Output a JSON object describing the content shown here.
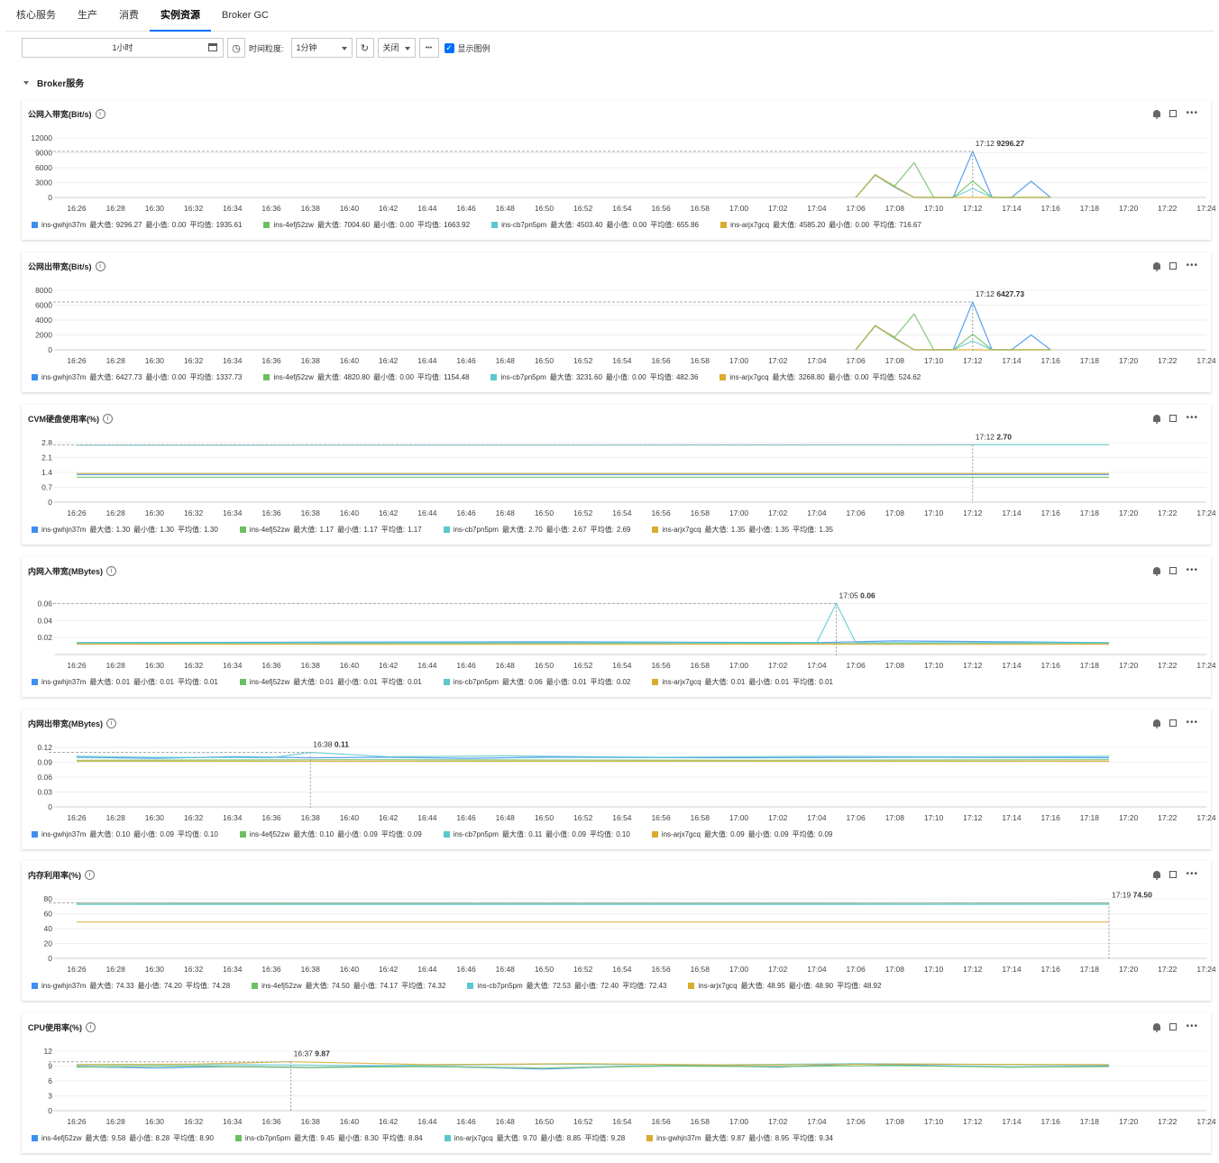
{
  "tabs": [
    {
      "label": "核心服务",
      "active": false
    },
    {
      "label": "生产",
      "active": false
    },
    {
      "label": "消费",
      "active": false
    },
    {
      "label": "实例资源",
      "active": true
    },
    {
      "label": "Broker GC",
      "active": false
    }
  ],
  "toolbar": {
    "range_value": "1小时",
    "granularity_label": "时间粒度:",
    "granularity_value": "1分钟",
    "refresh_value": "关闭",
    "more_label": "•••",
    "show_legend_label": "显示图例"
  },
  "section_title": "Broker服务",
  "legend_labels": {
    "max": "最大值:",
    "min": "最小值:",
    "avg": "平均值:"
  },
  "colors": {
    "blue": "#3d8ff0",
    "green": "#6cbf62",
    "teal": "#5bc8cf",
    "gold": "#d8ac2c",
    "accent": "#006eff"
  },
  "x_ticks": [
    "16:26",
    "16:28",
    "16:30",
    "16:32",
    "16:34",
    "16:36",
    "16:38",
    "16:40",
    "16:42",
    "16:44",
    "16:46",
    "16:48",
    "16:50",
    "16:52",
    "16:54",
    "16:56",
    "16:58",
    "17:00",
    "17:02",
    "17:04",
    "17:06",
    "17:08",
    "17:10",
    "17:12",
    "17:14",
    "17:16",
    "17:18",
    "17:20",
    "17:22",
    "17:24"
  ],
  "chart_data": [
    {
      "type": "line",
      "title": "公网入带宽(Bit/s)",
      "ylim": [
        0,
        12000
      ],
      "yticks": [
        "12000",
        "9000",
        "6000",
        "3000",
        "0"
      ],
      "x_range": [
        "16:26",
        "17:24"
      ],
      "tooltip": {
        "time": "17:12",
        "value": "9296.27"
      },
      "series": [
        {
          "name": "ins-gwhjn37m",
          "color": "blue",
          "max": "9296.27",
          "min": "0.00",
          "avg": "1935.61",
          "x": [
            "17:06",
            "17:07",
            "17:08",
            "17:09",
            "17:10",
            "17:11",
            "17:12",
            "17:13",
            "17:14",
            "17:15",
            "17:16"
          ],
          "values": [
            0,
            4585,
            2200,
            0,
            0,
            0,
            9296,
            0,
            0,
            3268,
            0
          ]
        },
        {
          "name": "ins-4efj52zw",
          "color": "green",
          "max": "7004.60",
          "min": "0.00",
          "avg": "1663.92",
          "x": [
            "17:06",
            "17:07",
            "17:08",
            "17:09",
            "17:10",
            "17:11",
            "17:12",
            "17:13",
            "17:14",
            "17:15",
            "17:16"
          ],
          "values": [
            0,
            4500,
            2300,
            7004,
            0,
            0,
            3300,
            0,
            0,
            0,
            0
          ]
        },
        {
          "name": "ins-cb7pn5pm",
          "color": "teal",
          "max": "4503.40",
          "min": "0.00",
          "avg": "655.86",
          "x": [
            "17:06",
            "17:07",
            "17:08",
            "17:09",
            "17:10",
            "17:11",
            "17:12",
            "17:13",
            "17:14",
            "17:15",
            "17:16"
          ],
          "values": [
            0,
            4503,
            2000,
            0,
            0,
            0,
            1800,
            0,
            0,
            0,
            0
          ]
        },
        {
          "name": "ins-arjx7gcq",
          "color": "gold",
          "max": "4585.20",
          "min": "0.00",
          "avg": "716.67",
          "x": [
            "17:06",
            "17:07",
            "17:08",
            "17:09",
            "17:10",
            "17:11",
            "17:12",
            "17:13",
            "17:14",
            "17:15",
            "17:16"
          ],
          "values": [
            0,
            4585,
            2200,
            0,
            0,
            0,
            0,
            0,
            0,
            0,
            0
          ]
        }
      ]
    },
    {
      "type": "line",
      "title": "公网出带宽(Bit/s)",
      "ylim": [
        0,
        8000
      ],
      "yticks": [
        "8000",
        "6000",
        "4000",
        "2000",
        "0"
      ],
      "x_range": [
        "16:26",
        "17:24"
      ],
      "tooltip": {
        "time": "17:12",
        "value": "6427.73"
      },
      "series": [
        {
          "name": "ins-gwhjn37m",
          "color": "blue",
          "max": "6427.73",
          "min": "0.00",
          "avg": "1337.73",
          "x": [
            "17:06",
            "17:07",
            "17:08",
            "17:09",
            "17:10",
            "17:11",
            "17:12",
            "17:13",
            "17:14",
            "17:15",
            "17:16"
          ],
          "values": [
            0,
            3268,
            1600,
            0,
            0,
            0,
            6427,
            0,
            0,
            2000,
            0
          ]
        },
        {
          "name": "ins-4efj52zw",
          "color": "green",
          "max": "4820.80",
          "min": "0.00",
          "avg": "1154.48",
          "x": [
            "17:06",
            "17:07",
            "17:08",
            "17:09",
            "17:10",
            "17:11",
            "17:12",
            "17:13",
            "17:14",
            "17:15",
            "17:16"
          ],
          "values": [
            0,
            3200,
            1700,
            4820,
            0,
            0,
            2100,
            0,
            0,
            0,
            0
          ]
        },
        {
          "name": "ins-cb7pn5pm",
          "color": "teal",
          "max": "3231.60",
          "min": "0.00",
          "avg": "482.36",
          "x": [
            "17:06",
            "17:07",
            "17:08",
            "17:09",
            "17:10",
            "17:11",
            "17:12",
            "17:13",
            "17:14",
            "17:15",
            "17:16"
          ],
          "values": [
            0,
            3231,
            1500,
            0,
            0,
            0,
            1200,
            0,
            0,
            0,
            0
          ]
        },
        {
          "name": "ins-arjx7gcq",
          "color": "gold",
          "max": "3268.80",
          "min": "0.00",
          "avg": "524.62",
          "x": [
            "17:06",
            "17:07",
            "17:08",
            "17:09",
            "17:10",
            "17:11",
            "17:12",
            "17:13",
            "17:14",
            "17:15",
            "17:16"
          ],
          "values": [
            0,
            3268,
            1600,
            0,
            0,
            0,
            0,
            0,
            0,
            0,
            0
          ]
        }
      ]
    },
    {
      "type": "line",
      "title": "CVM硬盘使用率(%)",
      "ylim": [
        0,
        2.8
      ],
      "yticks": [
        "2.8",
        "2.1",
        "1.4",
        "0.7",
        "0"
      ],
      "x_range": [
        "16:26",
        "17:24"
      ],
      "tooltip": {
        "time": "17:12",
        "value": "2.70"
      },
      "series": [
        {
          "name": "ins-gwhjn37m",
          "color": "blue",
          "max": "1.30",
          "min": "1.30",
          "avg": "1.30",
          "x": [
            "16:26",
            "17:19"
          ],
          "values": [
            1.3,
            1.3
          ]
        },
        {
          "name": "ins-4efj52zw",
          "color": "green",
          "max": "1.17",
          "min": "1.17",
          "avg": "1.17",
          "x": [
            "16:26",
            "17:19"
          ],
          "values": [
            1.17,
            1.17
          ]
        },
        {
          "name": "ins-cb7pn5pm",
          "color": "teal",
          "max": "2.70",
          "min": "2.67",
          "avg": "2.69",
          "x": [
            "16:26",
            "16:50",
            "17:12",
            "17:19"
          ],
          "values": [
            2.68,
            2.69,
            2.7,
            2.7
          ]
        },
        {
          "name": "ins-arjx7gcq",
          "color": "gold",
          "max": "1.35",
          "min": "1.35",
          "avg": "1.35",
          "x": [
            "16:26",
            "17:19"
          ],
          "values": [
            1.35,
            1.35
          ]
        }
      ]
    },
    {
      "type": "line",
      "title": "内网入带宽(MBytes)",
      "ylim": [
        0,
        0.07
      ],
      "yticks": [
        "0.06",
        "0.04",
        "0.02"
      ],
      "ytick_values": [
        0.06,
        0.04,
        0.02
      ],
      "x_range": [
        "16:26",
        "17:24"
      ],
      "tooltip": {
        "time": "17:05",
        "value": "0.06"
      },
      "series": [
        {
          "name": "ins-gwhjn37m",
          "color": "blue",
          "max": "0.01",
          "min": "0.01",
          "avg": "0.01",
          "x": [
            "16:26",
            "16:50",
            "17:04",
            "17:08",
            "17:19"
          ],
          "values": [
            0.014,
            0.015,
            0.014,
            0.016,
            0.014
          ]
        },
        {
          "name": "ins-4efj52zw",
          "color": "green",
          "max": "0.01",
          "min": "0.01",
          "avg": "0.01",
          "x": [
            "16:26",
            "17:19"
          ],
          "values": [
            0.013,
            0.013
          ]
        },
        {
          "name": "ins-cb7pn5pm",
          "color": "teal",
          "max": "0.06",
          "min": "0.01",
          "avg": "0.02",
          "x": [
            "16:26",
            "17:04",
            "17:05",
            "17:06",
            "17:19"
          ],
          "values": [
            0.014,
            0.014,
            0.06,
            0.014,
            0.014
          ]
        },
        {
          "name": "ins-arjx7gcq",
          "color": "gold",
          "max": "0.01",
          "min": "0.01",
          "avg": "0.01",
          "x": [
            "16:26",
            "17:19"
          ],
          "values": [
            0.012,
            0.012
          ]
        }
      ]
    },
    {
      "type": "line",
      "title": "内网出带宽(MBytes)",
      "ylim": [
        0,
        0.12
      ],
      "yticks": [
        "0.12",
        "0.09",
        "0.06",
        "0.03",
        "0"
      ],
      "x_range": [
        "16:26",
        "17:24"
      ],
      "tooltip": {
        "time": "16:38",
        "value": "0.11"
      },
      "series": [
        {
          "name": "ins-gwhjn37m",
          "color": "blue",
          "max": "0.10",
          "min": "0.09",
          "avg": "0.10",
          "x": [
            "16:26",
            "16:30",
            "16:34",
            "16:38",
            "16:42",
            "16:46",
            "16:50",
            "17:00",
            "17:10",
            "17:19"
          ],
          "values": [
            0.1,
            0.098,
            0.101,
            0.099,
            0.1,
            0.098,
            0.1,
            0.099,
            0.1,
            0.099
          ]
        },
        {
          "name": "ins-4efj52zw",
          "color": "green",
          "max": "0.10",
          "min": "0.09",
          "avg": "0.09",
          "x": [
            "16:26",
            "16:40",
            "17:00",
            "17:19"
          ],
          "values": [
            0.094,
            0.095,
            0.094,
            0.095
          ]
        },
        {
          "name": "ins-cb7pn5pm",
          "color": "teal",
          "max": "0.11",
          "min": "0.09",
          "avg": "0.10",
          "x": [
            "16:26",
            "16:30",
            "16:36",
            "16:38",
            "16:42",
            "16:48",
            "16:56",
            "17:04",
            "17:12",
            "17:19"
          ],
          "values": [
            0.102,
            0.1,
            0.099,
            0.11,
            0.101,
            0.103,
            0.1,
            0.102,
            0.101,
            0.102
          ]
        },
        {
          "name": "ins-arjx7gcq",
          "color": "gold",
          "max": "0.09",
          "min": "0.09",
          "avg": "0.09",
          "x": [
            "16:26",
            "17:19"
          ],
          "values": [
            0.092,
            0.092
          ]
        }
      ]
    },
    {
      "type": "line",
      "title": "内存利用率(%)",
      "ylim": [
        0,
        80
      ],
      "yticks": [
        "80",
        "60",
        "40",
        "20",
        "0"
      ],
      "x_range": [
        "16:26",
        "17:24"
      ],
      "tooltip": {
        "time": "17:19",
        "value": "74.50"
      },
      "series": [
        {
          "name": "ins-gwhjn37m",
          "color": "blue",
          "max": "74.33",
          "min": "74.20",
          "avg": "74.28",
          "x": [
            "16:26",
            "17:19"
          ],
          "values": [
            74.3,
            74.3
          ]
        },
        {
          "name": "ins-4efj52zw",
          "color": "green",
          "max": "74.50",
          "min": "74.17",
          "avg": "74.32",
          "x": [
            "16:26",
            "17:19"
          ],
          "values": [
            74.2,
            74.5
          ]
        },
        {
          "name": "ins-cb7pn5pm",
          "color": "teal",
          "max": "72.53",
          "min": "72.40",
          "avg": "72.43",
          "x": [
            "16:26",
            "17:19"
          ],
          "values": [
            72.4,
            72.5
          ]
        },
        {
          "name": "ins-arjx7gcq",
          "color": "gold",
          "max": "48.95",
          "min": "48.90",
          "avg": "48.92",
          "x": [
            "16:26",
            "17:19"
          ],
          "values": [
            48.9,
            48.9
          ]
        }
      ]
    },
    {
      "type": "line",
      "title": "CPU使用率(%)",
      "ylim": [
        0,
        12
      ],
      "yticks": [
        "12",
        "9",
        "6",
        "3",
        "0"
      ],
      "x_range": [
        "16:26",
        "17:24"
      ],
      "tooltip": {
        "time": "16:37",
        "value": "9.87"
      },
      "series": [
        {
          "name": "ins-4efj52zw",
          "color": "blue",
          "max": "9.58",
          "min": "8.28",
          "avg": "8.90",
          "x": [
            "16:26",
            "16:30",
            "16:34",
            "16:38",
            "16:42",
            "16:46",
            "16:50",
            "16:54",
            "16:58",
            "17:02",
            "17:06",
            "17:10",
            "17:14",
            "17:19"
          ],
          "values": [
            8.9,
            8.6,
            8.9,
            8.7,
            9.0,
            8.8,
            8.4,
            8.9,
            9.1,
            8.8,
            9.4,
            9.1,
            8.8,
            9.0
          ]
        },
        {
          "name": "ins-cb7pn5pm",
          "color": "green",
          "max": "9.45",
          "min": "8.30",
          "avg": "8.84",
          "x": [
            "16:26",
            "16:32",
            "16:38",
            "16:44",
            "16:50",
            "16:56",
            "17:02",
            "17:08",
            "17:14",
            "17:19"
          ],
          "values": [
            8.8,
            9.0,
            8.7,
            8.9,
            8.6,
            9.0,
            8.9,
            9.1,
            8.8,
            8.9
          ]
        },
        {
          "name": "ins-arjx7gcq",
          "color": "teal",
          "max": "9.70",
          "min": "8.85",
          "avg": "9.28",
          "x": [
            "16:26",
            "16:34",
            "16:42",
            "16:50",
            "16:58",
            "17:06",
            "17:14",
            "17:19"
          ],
          "values": [
            9.2,
            9.3,
            9.1,
            9.4,
            9.2,
            9.5,
            9.3,
            9.2
          ]
        },
        {
          "name": "ins-gwhjn37m",
          "color": "gold",
          "max": "9.87",
          "min": "8.95",
          "avg": "9.34",
          "x": [
            "16:26",
            "16:32",
            "16:37",
            "16:44",
            "16:52",
            "17:00",
            "17:08",
            "17:19"
          ],
          "values": [
            9.3,
            9.4,
            9.87,
            9.3,
            9.5,
            9.2,
            9.4,
            9.3
          ]
        }
      ]
    }
  ]
}
